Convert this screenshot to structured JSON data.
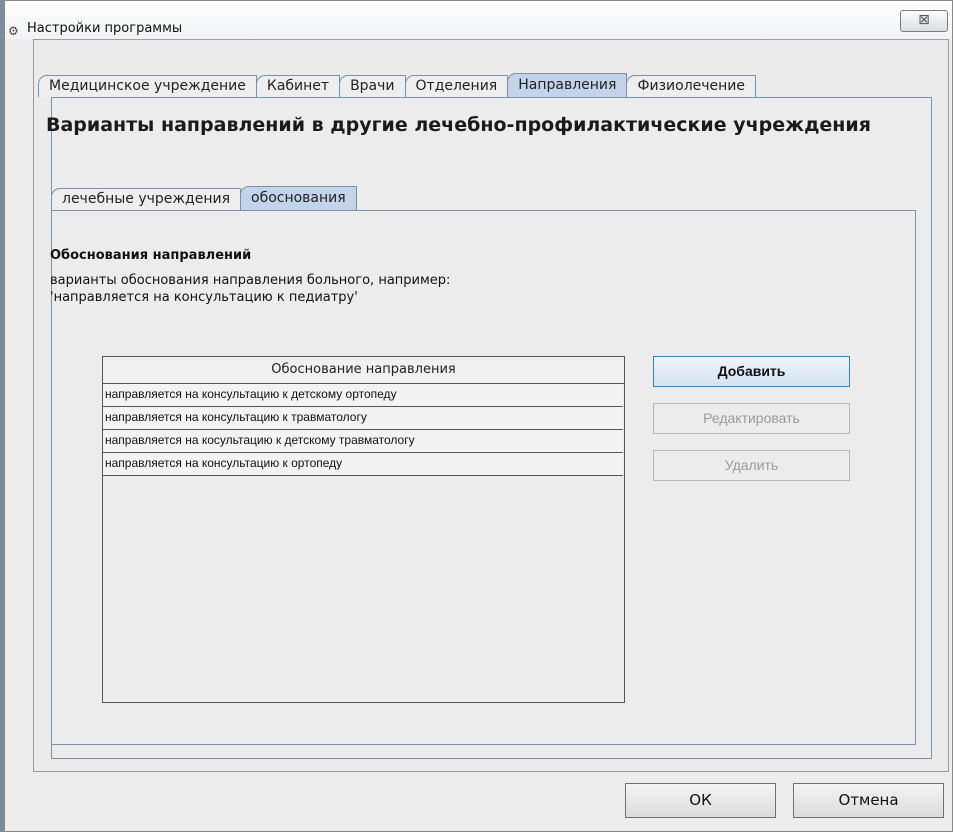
{
  "window": {
    "title": "Настройки программы",
    "close_symbol": "⊠",
    "app_icon": "settings-app-icon"
  },
  "outer_tabs": [
    {
      "label": "Медицинское учреждение"
    },
    {
      "label": "Кабинет"
    },
    {
      "label": "Врачи"
    },
    {
      "label": "Отделения"
    },
    {
      "label": "Направления",
      "active": true
    },
    {
      "label": "Физиолечение"
    }
  ],
  "heading": "Варианты направлений в другие лечебно-профилактические учреждения",
  "inner_tabs": [
    {
      "label": "лечебные учреждения"
    },
    {
      "label": "обоснования",
      "active": true
    }
  ],
  "section": {
    "title": "Обоснования направлений",
    "description": "варианты обоснования направления больного, например:\n'направляется на консультацию к педиатру'"
  },
  "table": {
    "header": "Обоснование направления",
    "rows": [
      "направляется на консультацию к детскому ортопеду",
      "направляется на консультацию к травматологу",
      "направляется на косультацию к детскому травматологу",
      "направляется на консультацию к ортопеду"
    ]
  },
  "buttons": {
    "add": "Добавить",
    "edit": "Редактировать",
    "delete": "Удалить",
    "ok": "ОК",
    "cancel": "Отмена"
  },
  "colors": {
    "active_tab": "#c3d4ea",
    "tab_border": "#7e8fa6",
    "primary_button_border": "#3c7fb1"
  }
}
